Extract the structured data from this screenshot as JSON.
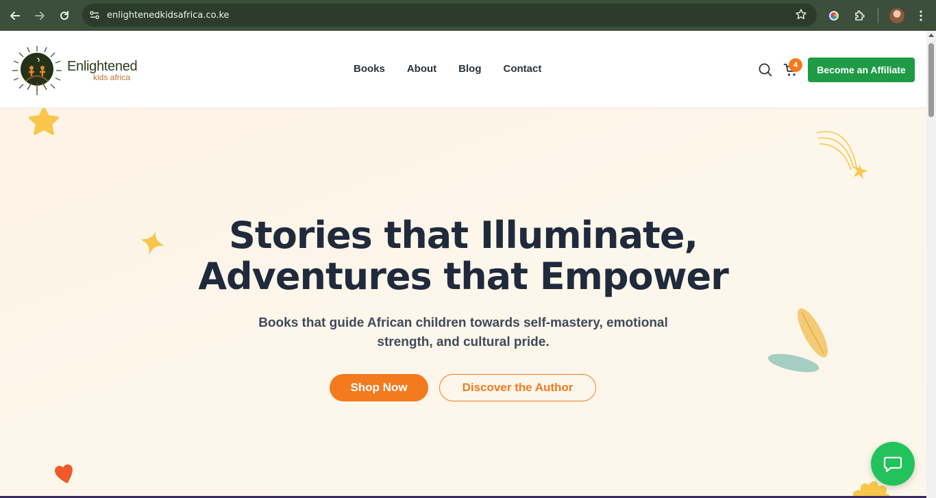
{
  "browser": {
    "url": "enlightenedkidsafrica.co.ke",
    "icons": [
      "back-icon",
      "forward-icon",
      "reload-icon",
      "site-settings-icon",
      "bookmark-star-icon",
      "extension-color-icon",
      "extensions-puzzle-icon",
      "profile-avatar",
      "menu-kebab-icon"
    ]
  },
  "header": {
    "logo_title": "Enlightened",
    "logo_sub": "kids africa",
    "nav": [
      {
        "label": "Books"
      },
      {
        "label": "About"
      },
      {
        "label": "Blog"
      },
      {
        "label": "Contact"
      }
    ],
    "cart_count": "4",
    "affiliate_label": "Become an Affiliate"
  },
  "hero": {
    "title_line1": "Stories that Illuminate,",
    "title_line2": "Adventures that Empower",
    "subtitle_line1": "Books that guide African children towards self-mastery, emotional",
    "subtitle_line2": "strength, and cultural pride.",
    "shop_label": "Shop Now",
    "author_label": "Discover the Author"
  },
  "colors": {
    "browser_chrome": "#3b4f3b",
    "accent_orange": "#f47a1f",
    "affiliate_green": "#1f9b45",
    "chat_green": "#22c35a",
    "hero_bg": "#fdf6ea",
    "heading": "#1f2a3c"
  }
}
